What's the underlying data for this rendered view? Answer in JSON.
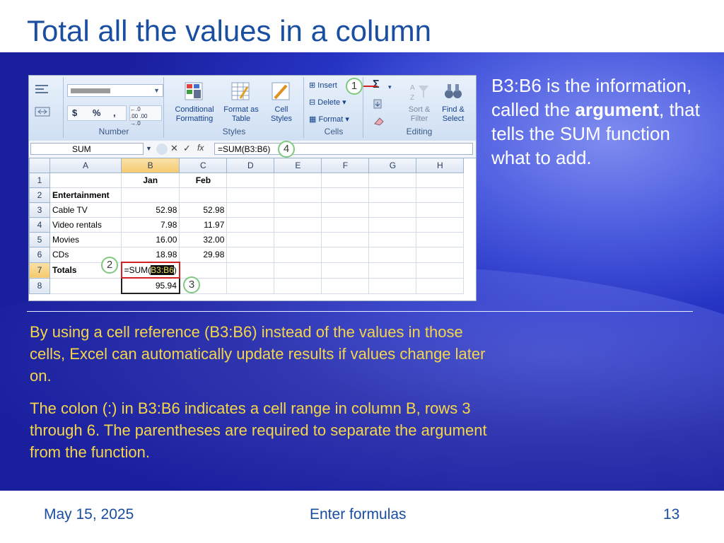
{
  "slide": {
    "title": "Total all the values in a column",
    "side_text_pre": "B3:B6 is the information, called the ",
    "side_text_bold": "argument",
    "side_text_post": ", that tells the SUM function what to add.",
    "para1": "By using a cell reference (B3:B6) instead of the values in those cells, Excel can automatically update results if values change later on.",
    "para2": "The colon (:) in B3:B6 indicates a cell range in column B, rows 3 through 6. The parentheses are required to separate the argument from the function.",
    "footer_date": "May 15, 2025",
    "footer_title": "Enter formulas",
    "footer_page": "13"
  },
  "ribbon": {
    "number_group": "Number",
    "number_buttons": [
      "$",
      "%",
      ","
    ],
    "styles_group": "Styles",
    "conditional_formatting": "Conditional Formatting",
    "format_as_table": "Format as Table",
    "cell_styles": "Cell Styles",
    "cells_group": "Cells",
    "insert": "Insert",
    "delete": "Delete",
    "format": "Format",
    "editing_group": "Editing",
    "sum_symbol": "Σ",
    "sort_filter": "Sort & Filter",
    "find_select": "Find & Select"
  },
  "formula_bar": {
    "name_box": "SUM",
    "fx_label": "fx",
    "formula": "=SUM(B3:B6)"
  },
  "callouts": [
    "1",
    "2",
    "3",
    "4"
  ],
  "sheet": {
    "columns": [
      "",
      "A",
      "B",
      "C",
      "D",
      "E",
      "F",
      "G",
      "H"
    ],
    "rows": [
      {
        "n": "1",
        "a": "",
        "b": "Jan",
        "c": "Feb"
      },
      {
        "n": "2",
        "a": "Entertainment",
        "b": "",
        "c": ""
      },
      {
        "n": "3",
        "a": "Cable TV",
        "b": "52.98",
        "c": "52.98"
      },
      {
        "n": "4",
        "a": "Video rentals",
        "b": "7.98",
        "c": "11.97"
      },
      {
        "n": "5",
        "a": "Movies",
        "b": "16.00",
        "c": "32.00"
      },
      {
        "n": "6",
        "a": "CDs",
        "b": "18.98",
        "c": "29.98"
      },
      {
        "n": "7",
        "a": "Totals",
        "b_pre": "=SUM(",
        "b_arg": "B3:B6",
        "b_post": ")",
        "c": ""
      },
      {
        "n": "8",
        "a": "",
        "b": "95.94",
        "c": ""
      }
    ]
  },
  "colors": {
    "title": "#1a4ea0",
    "body_text": "#f5d64a",
    "callout_ring": "#7fc97f",
    "active_border": "#d32020"
  }
}
